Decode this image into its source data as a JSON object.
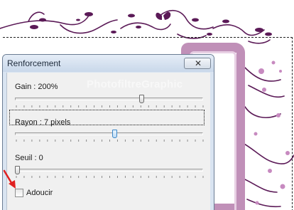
{
  "dialog": {
    "title": "Renforcement",
    "close_icon": "close-icon"
  },
  "gain": {
    "label": "Gain : 200%",
    "value_fraction": 0.68
  },
  "rayon": {
    "label": "Rayon : 7 pixels",
    "value_fraction": 0.53
  },
  "seuil": {
    "label": "Seuil : 0",
    "value_fraction": 0.0
  },
  "adoucir": {
    "label": "Adoucir",
    "checked": false
  },
  "watermark": {
    "text": "PhotofiltreGraphic"
  },
  "annotation": {
    "icon": "red-arrow-icon",
    "color": "#e02020"
  },
  "colors": {
    "ornament": "#5b1a57",
    "frame": "#c090b8",
    "dialog_bg": "#f0f0f0",
    "title_bg": "#d9e4f1"
  }
}
